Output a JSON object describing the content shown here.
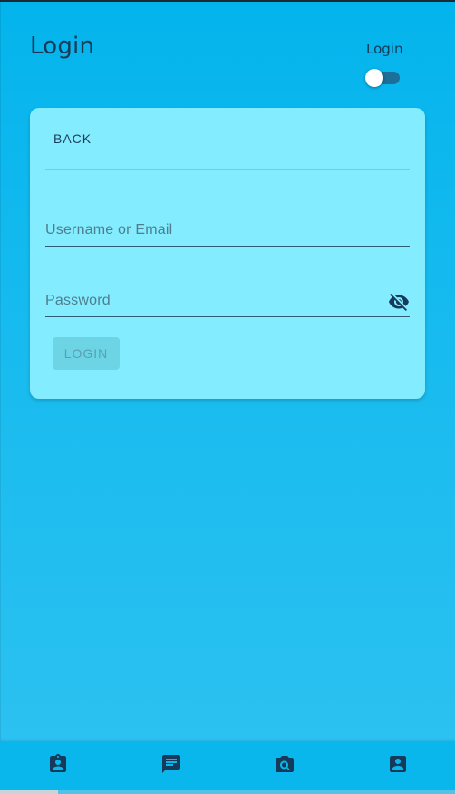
{
  "header": {
    "title": "Login",
    "toggle_label": "Login",
    "toggle_on": false
  },
  "card": {
    "back_label": "BACK",
    "username_placeholder": "Username or Email",
    "password_placeholder": "Password",
    "login_label": "LOGIN",
    "login_enabled": false
  },
  "bottom_nav": {
    "items": [
      {
        "icon": "contact-badge-icon"
      },
      {
        "icon": "chat-icon"
      },
      {
        "icon": "image-search-icon"
      },
      {
        "icon": "account-box-icon"
      }
    ]
  },
  "colors": {
    "background": "#03b4ec",
    "card": "#83ecff",
    "text": "#163a5a",
    "switch_track": "#1b6f99",
    "login_button_disabled": "#6cd4e4"
  }
}
